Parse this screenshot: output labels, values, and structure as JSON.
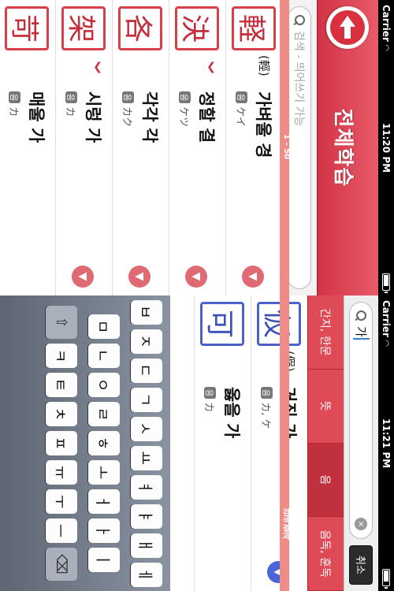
{
  "status_top": {
    "carrier": "Carrier",
    "time": "11:20 PM"
  },
  "status_bottom": {
    "carrier": "Carrier",
    "time": "11:21 PM"
  },
  "header": {
    "title": "전체학습"
  },
  "search": {
    "placeholder": "검색 - 띄어쓰기 가능"
  },
  "range_label": "1 - 50",
  "list_top": [
    {
      "kanji": "軽",
      "old_form": "(輕)",
      "meaning": "가벼울 경",
      "reading": "ケイ",
      "marked": false
    },
    {
      "kanji": "決",
      "old_form": "",
      "meaning": "정할 결",
      "reading": "ケツ",
      "marked": true
    },
    {
      "kanji": "各",
      "old_form": "",
      "meaning": "각각 각",
      "reading": "カク",
      "marked": false
    },
    {
      "kanji": "架",
      "old_form": "",
      "meaning": "시렁 가",
      "reading": "カ",
      "marked": true
    },
    {
      "kanji": "苛",
      "old_form": "",
      "meaning": "매울 가",
      "reading": "カ",
      "marked": false
    }
  ],
  "search_bottom": {
    "query": "가",
    "clear": "×",
    "cancel": "취소"
  },
  "scope_tabs": [
    "간지, 한문",
    "뜻",
    "음",
    "음독, 훈독"
  ],
  "results_label": "검색결과",
  "list_bottom": [
    {
      "kanji": "仮",
      "old_form": "(假)",
      "meaning": "거짓 가",
      "reading": "カ, ケ"
    },
    {
      "kanji": "可",
      "old_form": "",
      "meaning": "옳을 가",
      "reading": "カ"
    }
  ],
  "reading_badge": "음",
  "keyboard": {
    "row1": [
      "ㅂ",
      "ㅈ",
      "ㄷ",
      "ㄱ",
      "ㅅ",
      "ㅛ",
      "ㅕ",
      "ㅑ",
      "ㅐ",
      "ㅔ"
    ],
    "row2": [
      "ㅁ",
      "ㄴ",
      "ㅇ",
      "ㄹ",
      "ㅎ",
      "ㅗ",
      "ㅓ",
      "ㅏ",
      "ㅣ"
    ],
    "row3": [
      "ㅋ",
      "ㅌ",
      "ㅊ",
      "ㅍ",
      "ㅠ",
      "ㅜ",
      "ㅡ"
    ],
    "shift": "⇧",
    "delete": "⌫"
  },
  "colors": {
    "accent_red": "#d8303f",
    "accent_blue": "#4866d8"
  }
}
